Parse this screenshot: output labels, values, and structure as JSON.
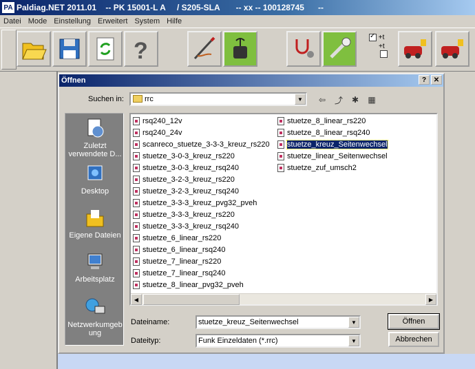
{
  "app": {
    "logo": "PA",
    "title": "Paldiag.NET 2011.01    -- PK 15001-L A     / S205-SLA       -- xx -- 100128745      --"
  },
  "menu": [
    "Datei",
    "Mode",
    "Einstellung",
    "Erweitert",
    "System",
    "Hilfe"
  ],
  "toolbar": {
    "buttons": [
      "open-folder-icon",
      "save-disk-icon",
      "refresh-icon",
      "help-question-icon",
      "probe-cable-icon",
      "gauge-device-icon",
      "stethoscope-icon",
      "tools-icon",
      "car-diag-icon-1",
      "car-diag-icon-2"
    ],
    "check_label_1": "+t",
    "check_label_2": "+t"
  },
  "dialog": {
    "title": "Öffnen",
    "help_btn": "?",
    "close_btn": "✕",
    "lookin_label": "Suchen in:",
    "lookin_value": "rrc",
    "places": [
      {
        "label": "Zuletzt verwendete D...",
        "icon": "recent-documents-icon"
      },
      {
        "label": "Desktop",
        "icon": "desktop-icon"
      },
      {
        "label": "Eigene Dateien",
        "icon": "my-documents-icon"
      },
      {
        "label": "Arbeitsplatz",
        "icon": "my-computer-icon"
      },
      {
        "label": "Netzwerkumgebung",
        "icon": "network-icon"
      }
    ],
    "files_col1": [
      "rsq240_12v",
      "rsq240_24v",
      "scanreco_stuetze_3-3-3_kreuz_rs220",
      "stuetze_3-0-3_kreuz_rs220",
      "stuetze_3-0-3_kreuz_rsq240",
      "stuetze_3-2-3_kreuz_rs220",
      "stuetze_3-2-3_kreuz_rsq240",
      "stuetze_3-3-3_kreuz_pvg32_pveh",
      "stuetze_3-3-3_kreuz_rs220",
      "stuetze_3-3-3_kreuz_rsq240",
      "stuetze_6_linear_rs220",
      "stuetze_6_linear_rsq240",
      "stuetze_7_linear_rs220",
      "stuetze_7_linear_rsq240",
      "stuetze_8_linear_pvg32_pveh"
    ],
    "files_col2": [
      "stuetze_8_linear_rs220",
      "stuetze_8_linear_rsq240",
      "stuetze_kreuz_Seitenwechsel",
      "stuetze_linear_Seitenwechsel",
      "stuetze_zuf_umsch2"
    ],
    "selected_file": "stuetze_kreuz_Seitenwechsel",
    "filename_label": "Dateiname:",
    "filename_value": "stuetze_kreuz_Seitenwechsel",
    "filetype_label": "Dateityp:",
    "filetype_value": "Funk Einzeldaten (*.rrc)",
    "open_button": "Öffnen",
    "cancel_button": "Abbrechen"
  }
}
